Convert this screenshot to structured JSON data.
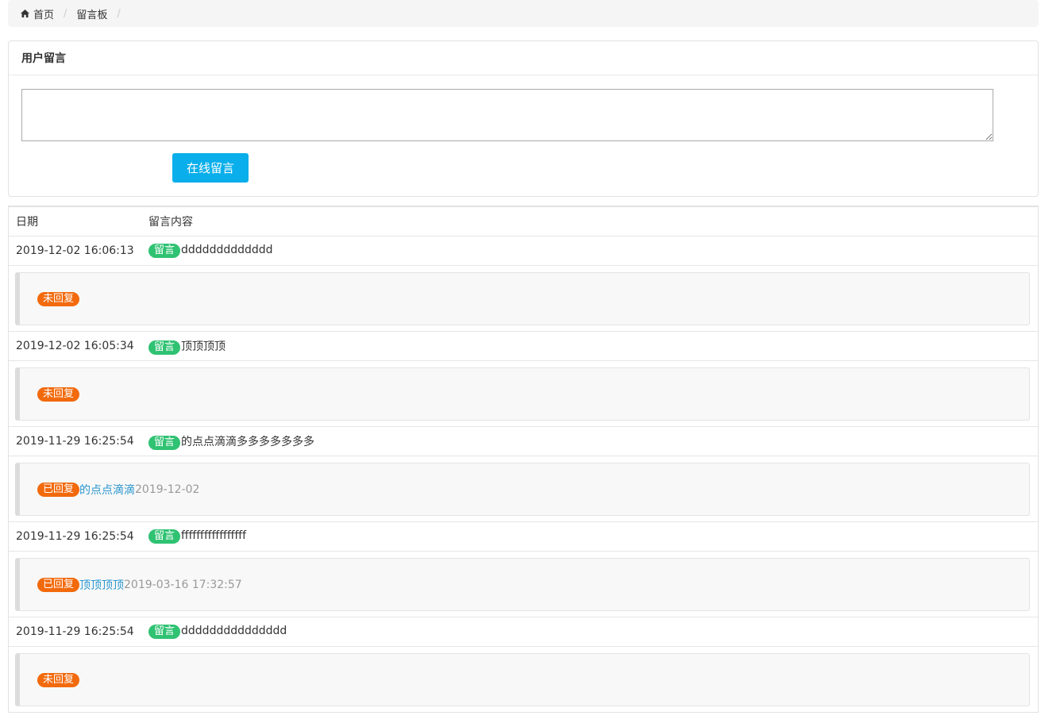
{
  "breadcrumb": {
    "home": "首页",
    "current": "留言板",
    "separator": "/"
  },
  "form": {
    "title": "用户留言",
    "textarea_value": "",
    "submit_label": "在线留言"
  },
  "table": {
    "headers": {
      "date": "日期",
      "content": "留言内容"
    },
    "msg_badge": "留言",
    "rows": [
      {
        "date": "2019-12-02 16:06:13",
        "content": "ddddddddddddd",
        "status": "未回复",
        "reply": "",
        "reply_time": ""
      },
      {
        "date": "2019-12-02 16:05:34",
        "content": "顶顶顶顶",
        "status": "未回复",
        "reply": "",
        "reply_time": ""
      },
      {
        "date": "2019-11-29 16:25:54",
        "content": "的点点滴滴多多多多多多多",
        "status": "已回复",
        "reply": "的点点滴滴",
        "reply_time": "2019-12-02"
      },
      {
        "date": "2019-11-29 16:25:54",
        "content": "fffffffffffffffff",
        "status": "已回复",
        "reply": "顶顶顶顶",
        "reply_time": "2019-03-16 17:32:57"
      },
      {
        "date": "2019-11-29 16:25:54",
        "content": "ddddddddddddddd",
        "status": "未回复",
        "reply": "",
        "reply_time": ""
      }
    ]
  },
  "colors": {
    "primary_button": "#09aeea",
    "badge_green": "#2fc272",
    "badge_orange": "#f26a0c",
    "link": "#2a96cf"
  },
  "icons": {
    "home": "home-icon"
  }
}
